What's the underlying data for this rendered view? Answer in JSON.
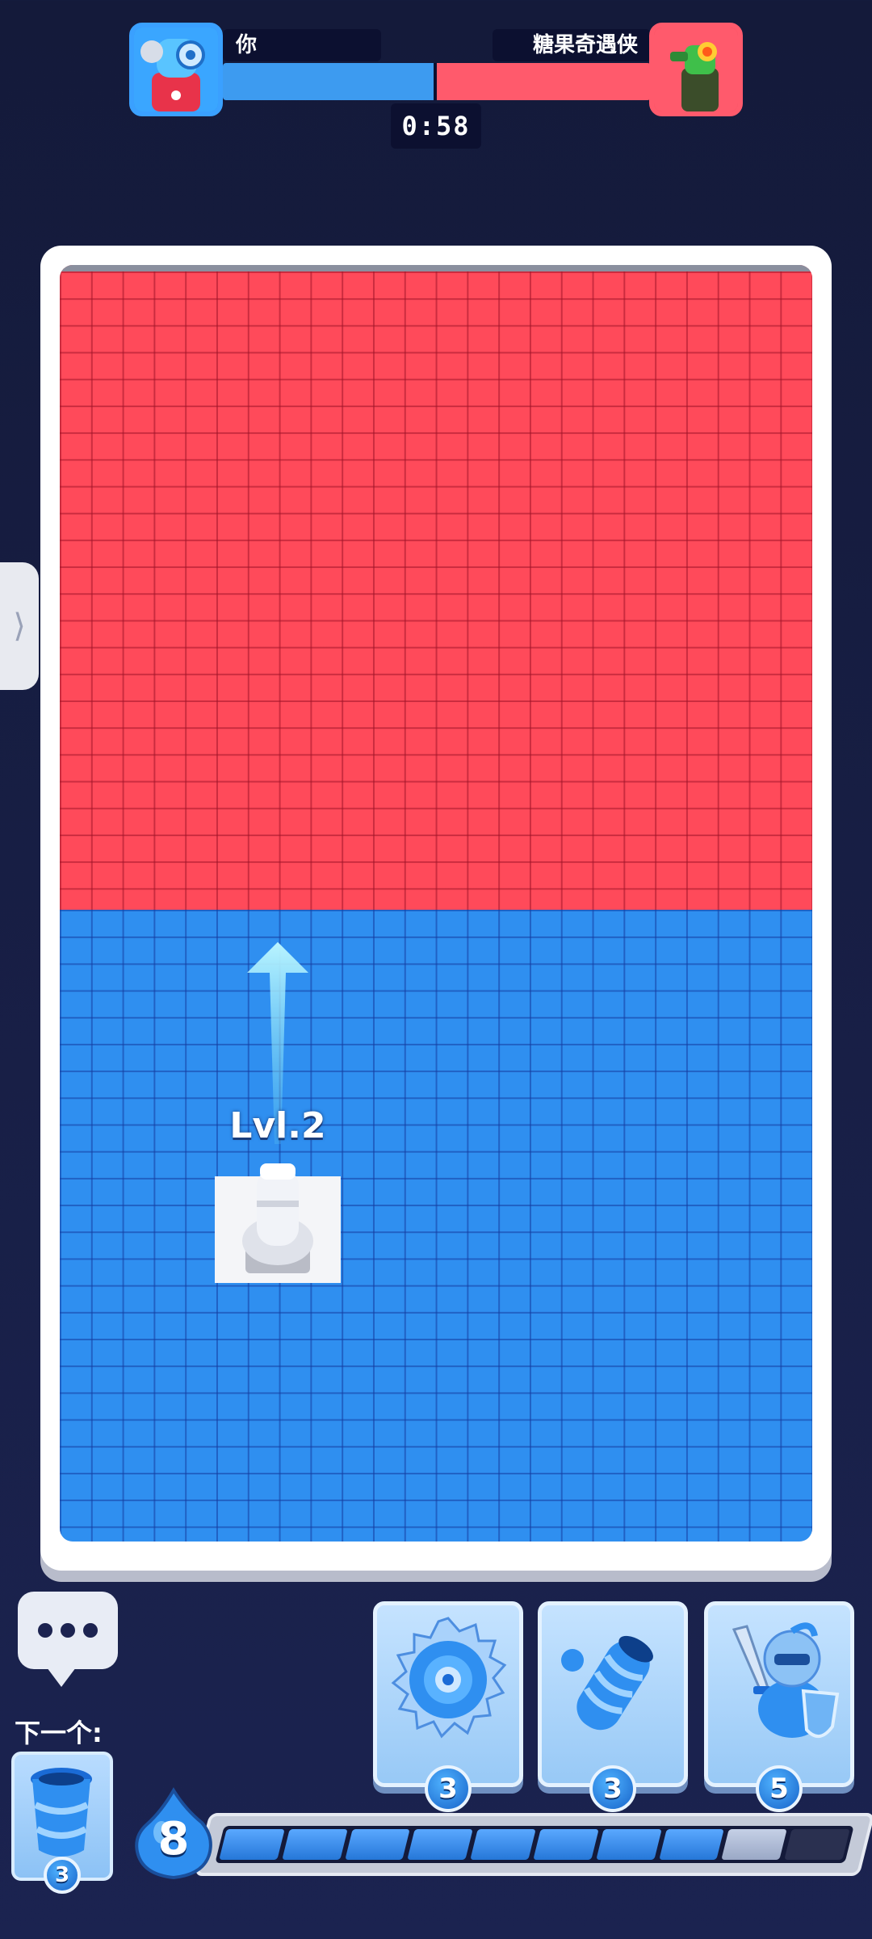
{
  "hud": {
    "player_name": "你",
    "opponent_name": "糖果奇遇侠",
    "timer": "0:58",
    "player_share": 0.5,
    "player_color": "#3d9bf0",
    "opponent_color": "#ff5a6c"
  },
  "board": {
    "red_color": "#ff4a5a",
    "blue_color": "#2f8ff0",
    "unit_label": "Lvl.2"
  },
  "bottom": {
    "next_label": "下一个:",
    "next_card_cost": "3",
    "elixir_count": "8",
    "elixir_fill": 0.82,
    "cards": [
      {
        "name": "saw-blade",
        "cost": "3"
      },
      {
        "name": "cannon",
        "cost": "3"
      },
      {
        "name": "knight",
        "cost": "5"
      }
    ]
  },
  "icons": [
    "player-avatar-icon",
    "opponent-avatar-icon",
    "chevron-right-icon",
    "chat-icon",
    "saw-blade-icon",
    "cannon-icon",
    "knight-icon",
    "elixir-drop-icon",
    "arrow-up-icon"
  ]
}
